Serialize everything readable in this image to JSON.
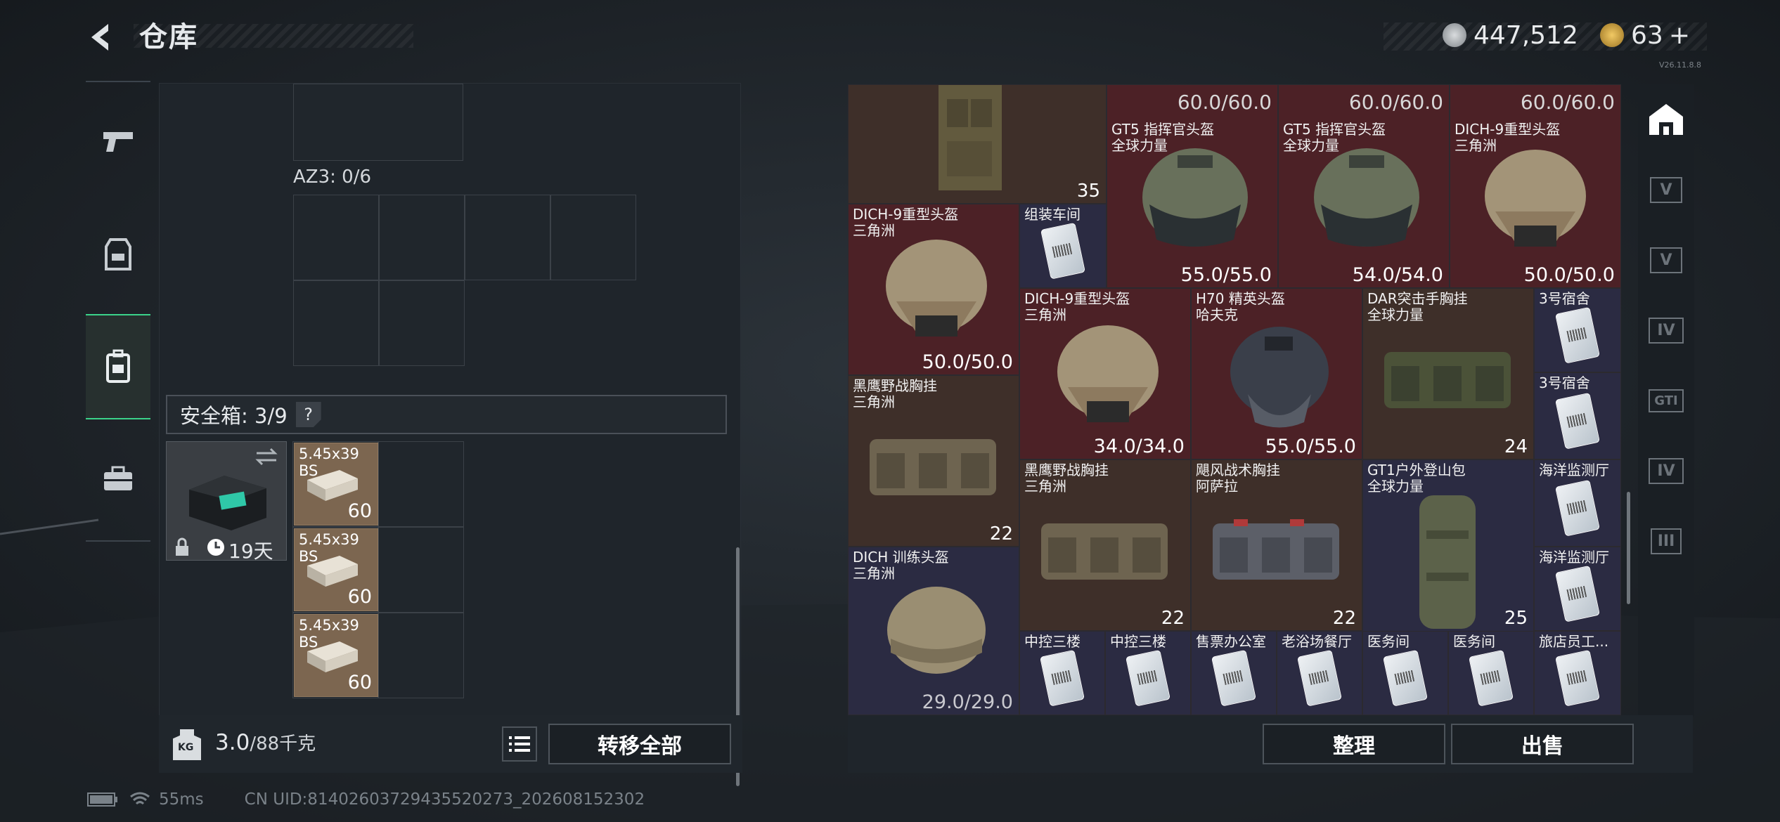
{
  "header": {
    "back_icon": "chevron-left-icon",
    "title": "仓库",
    "currency1": "447,512",
    "currency2": "63",
    "currency2_plus": "+",
    "version": "V26.11.8.8"
  },
  "left_nav": [
    {
      "name": "weapons",
      "icon": "pistol-icon"
    },
    {
      "name": "equipment",
      "icon": "vest-icon"
    },
    {
      "name": "backpack",
      "icon": "backpack-icon",
      "active": true
    },
    {
      "name": "case",
      "icon": "briefcase-icon"
    }
  ],
  "storage": {
    "container_label": "AZ3: 0/6",
    "safe_label": "安全箱: 3/9",
    "help": "?",
    "safebox_days": "19天",
    "ammo": [
      {
        "name": "5.45x39",
        "sub": "BS",
        "count": "60"
      },
      {
        "name": "5.45x39",
        "sub": "BS",
        "count": "60"
      },
      {
        "name": "5.45x39",
        "sub": "BS",
        "count": "60"
      }
    ],
    "weight_value": "3.0",
    "weight_max": "/88千克",
    "weight_icon": "KG",
    "transfer_all": "转移全部"
  },
  "inventory": {
    "items": [
      {
        "id": "i1",
        "name": "",
        "sub": "",
        "value": "35"
      },
      {
        "id": "i2",
        "name": "GT5 指挥官头盔",
        "sub": "全球力量",
        "dur_top": "60.0/60.0",
        "value": "55.0/55.0"
      },
      {
        "id": "i3",
        "name": "GT5 指挥官头盔",
        "sub": "全球力量",
        "dur_top": "60.0/60.0",
        "value": "54.0/54.0"
      },
      {
        "id": "i4",
        "name": "DICH-9重型头盔",
        "sub": "三角洲",
        "dur_top": "60.0/60.0",
        "value": "50.0/50.0"
      },
      {
        "id": "i5",
        "name": "DICH-9重型头盔",
        "sub": "三角洲",
        "value": "50.0/50.0"
      },
      {
        "id": "i6",
        "name": "组装车间",
        "sub": "",
        "value": ""
      },
      {
        "id": "i7",
        "name": "DICH-9重型头盔",
        "sub": "三角洲",
        "value": "34.0/34.0"
      },
      {
        "id": "i8",
        "name": "H70 精英头盔",
        "sub": "哈夫克",
        "value": "55.0/55.0"
      },
      {
        "id": "i9",
        "name": "DAR突击手胸挂",
        "sub": "全球力量",
        "value": "24"
      },
      {
        "id": "i10",
        "name": "3号宿舍",
        "sub": "",
        "value": ""
      },
      {
        "id": "i11",
        "name": "3号宿舍",
        "sub": "",
        "value": ""
      },
      {
        "id": "i12",
        "name": "黑鹰野战胸挂",
        "sub": "三角洲",
        "value": "22"
      },
      {
        "id": "i13",
        "name": "黑鹰野战胸挂",
        "sub": "三角洲",
        "value": "22"
      },
      {
        "id": "i14",
        "name": "飓风战术胸挂",
        "sub": "阿萨拉",
        "value": "22"
      },
      {
        "id": "i15",
        "name": "GT1户外登山包",
        "sub": "全球力量",
        "value": "25"
      },
      {
        "id": "i16",
        "name": "海洋监测厅",
        "sub": "",
        "value": ""
      },
      {
        "id": "i17",
        "name": "海洋监测厅",
        "sub": "",
        "value": ""
      },
      {
        "id": "i18",
        "name": "DICH 训练头盔",
        "sub": "三角洲",
        "value": "29.0/29.0"
      },
      {
        "id": "i19",
        "name": "中控三楼",
        "sub": "",
        "value": ""
      },
      {
        "id": "i20",
        "name": "中控三楼",
        "sub": "",
        "value": ""
      },
      {
        "id": "i21",
        "name": "售票办公室",
        "sub": "",
        "value": ""
      },
      {
        "id": "i22",
        "name": "老浴场餐厅",
        "sub": "",
        "value": ""
      },
      {
        "id": "i23",
        "name": "医务间",
        "sub": "",
        "value": ""
      },
      {
        "id": "i24",
        "name": "医务间",
        "sub": "",
        "value": ""
      },
      {
        "id": "i25",
        "name": "旅店员工...",
        "sub": "",
        "value": ""
      }
    ],
    "sort_button": "整理",
    "sell_button": "出售"
  },
  "right_nav": [
    {
      "icon": "storage-icon",
      "label": ""
    },
    {
      "icon": "level-v-icon",
      "label": "V"
    },
    {
      "icon": "level-v-icon",
      "label": "V"
    },
    {
      "icon": "level-iv-icon",
      "label": "IV"
    },
    {
      "icon": "gti-icon",
      "label": "GTI"
    },
    {
      "icon": "level-iv-icon",
      "label": "IV"
    },
    {
      "icon": "level-iii-icon",
      "label": "III"
    },
    {
      "icon": "gear-icon",
      "label": ""
    }
  ],
  "status_bar": {
    "ping": "55ms",
    "uid": "CN UID:814026037294355202​73_202608152302"
  }
}
